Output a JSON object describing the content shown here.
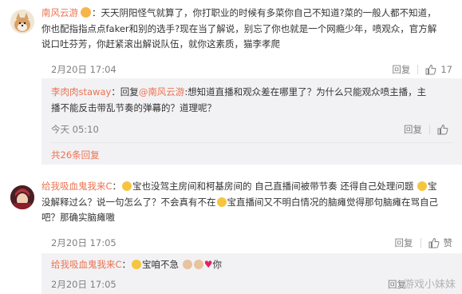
{
  "comment1": {
    "username": "南风云游",
    "badge_icon": "vip-badge-icon",
    "text_line1": "：天天阴阳怪气就算了，你打职业的时候有多菜你自己不知道?菜的一般人都不知道，",
    "text_line2": "你也配指指点点faker和别的选手?现在当了解说，别忘了你也就是一个网瘾少年，喷观众，官方解",
    "text_line3": "说口吐芬芳，你赶紧滚出解说队伍，就你这素质，猫李孝爬",
    "time": "2月20日 17:04",
    "reply_label": "回复",
    "like_count": "17",
    "reply": {
      "username": "李肉肉staway",
      "prefix": "：回复",
      "mention": "@南风云游",
      "text_line1": ":想知道直播和观众差在哪里了？为什么只能观众喷主播，主",
      "text_line2": "播不能反击带乱节奏的弹幕的？道理呢？",
      "time": "今天 05:10",
      "reply_label": "回复"
    },
    "more_replies": "共26条回复"
  },
  "comment2": {
    "username": "给我吸血鬼我来C",
    "text_line1a": "：",
    "text_line1b": "宝也没驾主房间和柯基房间的 自己直播间被带节奏 还得自己处理问题 ",
    "text_line1c": "宝",
    "text_line2": "没解释过么？说一句怎么了？不会真有不在",
    "text_line2b": "宝直播间又不明白情况的脑瘫觉得那句脑瘫在骂自己",
    "text_line3": "吧？那确实脑瘫嗷",
    "time": "2月20日 17:05",
    "reply_label": "回复",
    "like_label": "赞",
    "reply": {
      "username": "给我吸血鬼我来C",
      "text_a": "：",
      "text_b": "宝咱不急 ",
      "text_c": "你",
      "time": "2月20日 17:05",
      "reply_label": "回复"
    }
  },
  "watermark": "游戏小妹妹",
  "colors": {
    "accent": "#eb7350",
    "meta": "#808080",
    "reply_bg": "#f2f2f5"
  }
}
